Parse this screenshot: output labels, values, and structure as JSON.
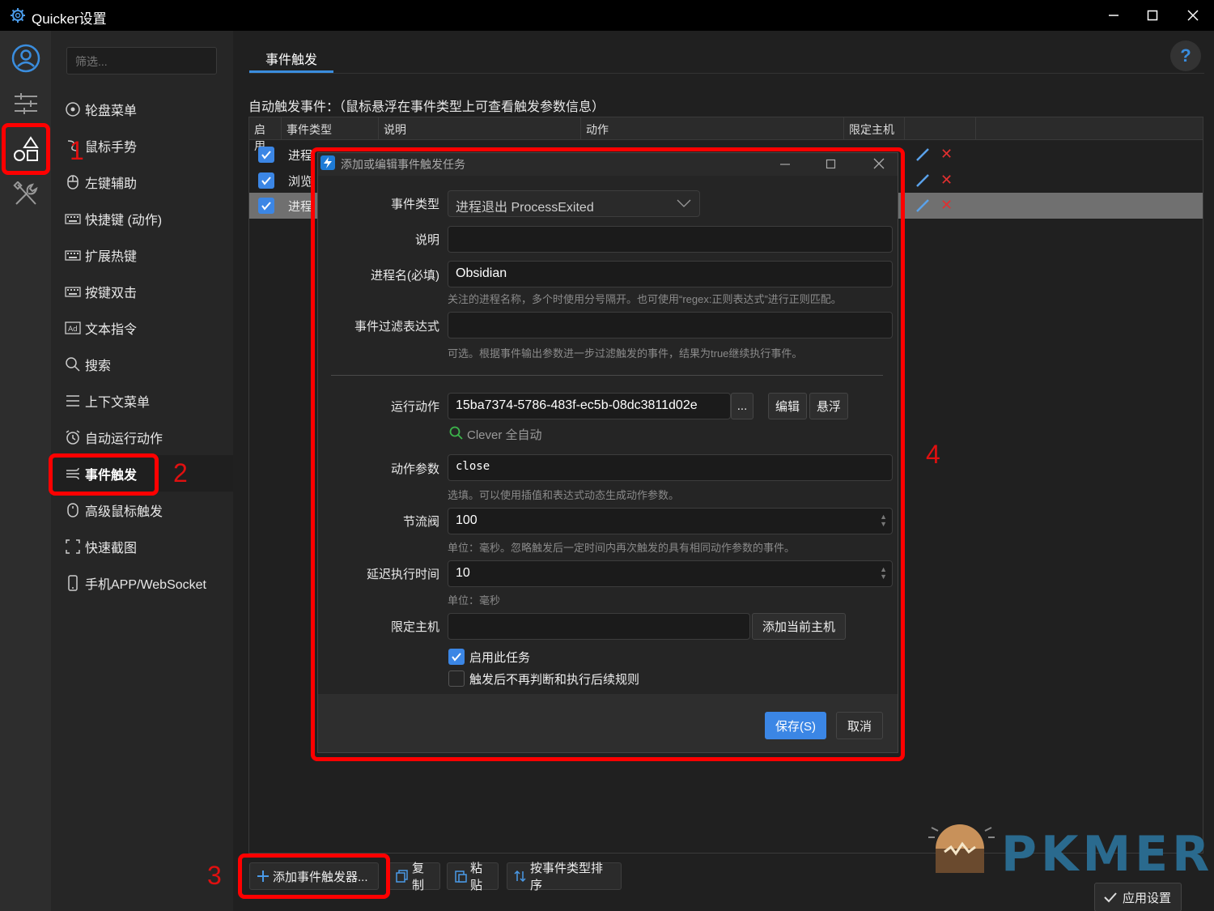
{
  "window": {
    "title": "Quicker设置"
  },
  "filter_placeholder": "筛选...",
  "menu": [
    {
      "label": "轮盘菜单",
      "icon": "wheel-icon"
    },
    {
      "label": "鼠标手势",
      "icon": "gesture-icon"
    },
    {
      "label": "左键辅助",
      "icon": "mouse-icon"
    },
    {
      "label": "快捷键 (动作)",
      "icon": "keyboard-icon"
    },
    {
      "label": "扩展热键",
      "icon": "keyboard-icon"
    },
    {
      "label": "按键双击",
      "icon": "keyboard-icon"
    },
    {
      "label": "文本指令",
      "icon": "text-command-icon"
    },
    {
      "label": "搜索",
      "icon": "search-icon"
    },
    {
      "label": "上下文菜单",
      "icon": "list-icon"
    },
    {
      "label": "自动运行动作",
      "icon": "alarm-icon"
    },
    {
      "label": "事件触发",
      "icon": "event-icon"
    },
    {
      "label": "高级鼠标触发",
      "icon": "mouse-icon"
    },
    {
      "label": "快速截图",
      "icon": "screenshot-icon"
    },
    {
      "label": "手机APP/WebSocket",
      "icon": "phone-icon"
    }
  ],
  "main": {
    "tab": "事件触发",
    "help": "?",
    "section_label": "自动触发事件：（鼠标悬浮在事件类型上可查看触发参数信息）",
    "columns": [
      "启用",
      "事件类型",
      "说明",
      "动作",
      "限定主机"
    ],
    "rows": [
      {
        "enabled": true,
        "type": "进程"
      },
      {
        "enabled": true,
        "type": "浏览"
      },
      {
        "enabled": true,
        "type": "进程"
      }
    ],
    "buttons": {
      "add": "添加事件触发器...",
      "copy": "复制",
      "paste": "粘贴",
      "sort": "按事件类型排序"
    },
    "apply": "应用设置"
  },
  "dialog": {
    "title": "添加或编辑事件触发任务",
    "event_type_label": "事件类型",
    "event_type_value": "进程退出 ProcessExited",
    "desc_label": "说明",
    "desc_value": "",
    "process_label": "进程名(必填)",
    "process_value": "Obsidian",
    "process_hint": "关注的进程名称，多个时使用分号隔开。也可使用“regex:正则表达式”进行正则匹配。",
    "filter_label": "事件过滤表达式",
    "filter_value": "",
    "filter_hint": "可选。根据事件输出参数进一步过滤触发的事件，结果为true继续执行事件。",
    "action_label": "运行动作",
    "action_value": "15ba7374-5786-483f-ec5b-08dc3811d02e",
    "action_more": "...",
    "edit_btn": "编辑",
    "float_btn": "悬浮",
    "action_name": "Clever 全自动",
    "param_label": "动作参数",
    "param_value": "close",
    "param_hint": "选填。可以使用插值和表达式动态生成动作参数。",
    "throttle_label": "节流阀",
    "throttle_value": "100",
    "throttle_hint": "单位：毫秒。忽略触发后一定时间内再次触发的具有相同动作参数的事件。",
    "delay_label": "延迟执行时间",
    "delay_value": "10",
    "delay_hint": "单位：毫秒",
    "host_label": "限定主机",
    "host_value": "",
    "add_host_btn": "添加当前主机",
    "enable_task": "启用此任务",
    "enable_task_checked": true,
    "stop_rules": "触发后不再判断和执行后续规则",
    "stop_rules_checked": false,
    "save": "保存(S)",
    "cancel": "取消"
  },
  "annotations": [
    "1",
    "2",
    "3",
    "4"
  ],
  "watermark": "PKMER",
  "colors": {
    "accent": "#3a8dde",
    "annotation": "#ff0000",
    "save": "#3b86e5"
  }
}
